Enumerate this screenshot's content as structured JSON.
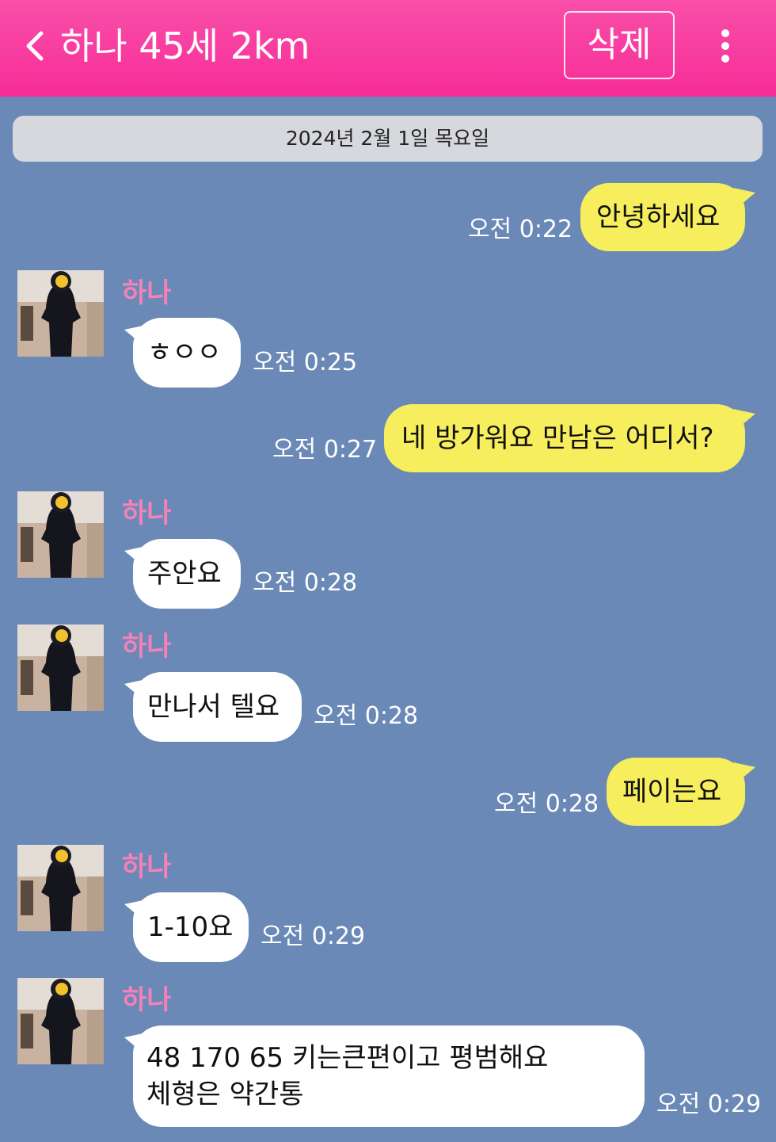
{
  "header": {
    "title": "하나 45세 2km",
    "delete_label": "삭제",
    "background_color": "#f72c97"
  },
  "date_separator": "2024년 2월 1일 목요일",
  "contact": {
    "name": "하나"
  },
  "messages": [
    {
      "direction": "outgoing",
      "text": "안녕하세요",
      "time": "오전 0:22"
    },
    {
      "direction": "incoming",
      "text": "ㅎㅇㅇ",
      "time": "오전 0:25"
    },
    {
      "direction": "outgoing",
      "text": "네 방가워요 만남은 어디서?",
      "time": "오전 0:27"
    },
    {
      "direction": "incoming",
      "text": "주안요",
      "time": "오전 0:28"
    },
    {
      "direction": "incoming",
      "text": "만나서 텔요",
      "time": "오전 0:28"
    },
    {
      "direction": "outgoing",
      "text": "페이는요",
      "time": "오전 0:28"
    },
    {
      "direction": "incoming",
      "text": "1-10요",
      "time": "오전 0:29"
    },
    {
      "direction": "incoming",
      "lines": [
        "48 170 65 키는큰편이고 평범해요",
        "체형은 약간통"
      ],
      "time": "오전 0:29"
    }
  ],
  "colors": {
    "chat_background": "#6a89b6",
    "outgoing_bubble": "#f6ee5d",
    "incoming_bubble": "#ffffff",
    "sender_name": "#f481b8"
  }
}
